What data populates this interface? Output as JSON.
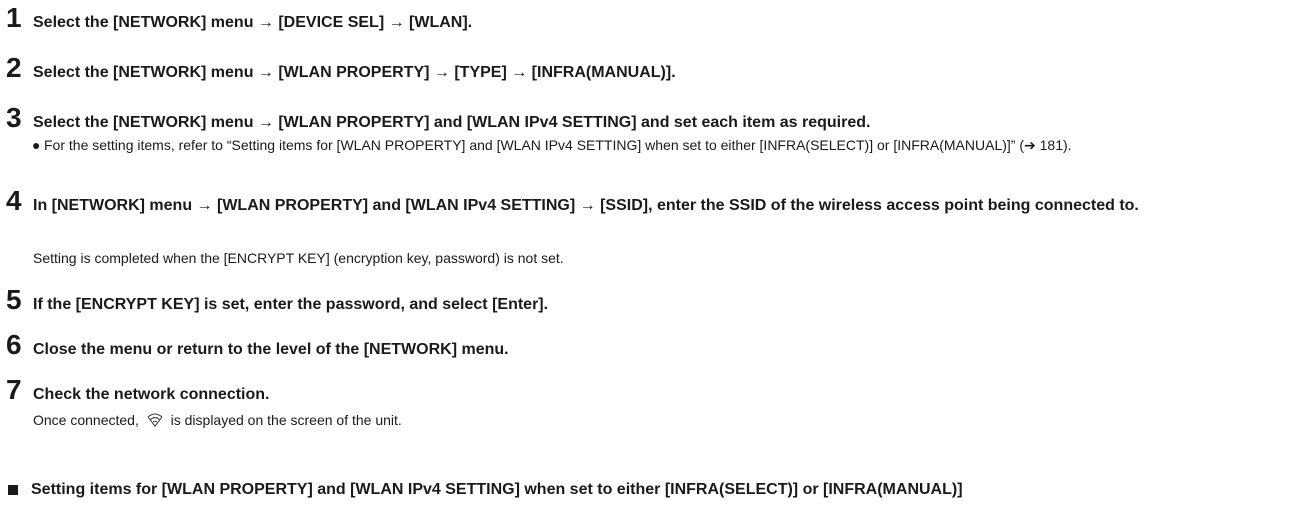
{
  "steps": [
    {
      "num": "1",
      "text": "Select the [NETWORK] menu → [DEVICE SEL] → [WLAN]."
    },
    {
      "num": "2",
      "text": "Select the [NETWORK] menu → [WLAN PROPERTY] → [TYPE] → [INFRA(MANUAL)]."
    },
    {
      "num": "3",
      "text": "Select the [NETWORK] menu → [WLAN PROPERTY] and [WLAN IPv4 SETTING] and set each item as required.",
      "bullet_mark": "●",
      "bullet": "For the setting items, refer to “Setting items for [WLAN PROPERTY] and [WLAN IPv4 SETTING] when set to either [INFRA(SELECT)] or [INFRA(MANUAL)]” (➔ 181)."
    },
    {
      "num": "4",
      "text": "In [NETWORK] menu → [WLAN PROPERTY] and [WLAN IPv4 SETTING] → [SSID], enter the SSID of the wireless access point being connected to.",
      "note": "Setting is completed when the [ENCRYPT KEY] (encryption key, password) is not set."
    },
    {
      "num": "5",
      "text": "If the [ENCRYPT KEY] is set, enter the password, and select [Enter]."
    },
    {
      "num": "6",
      "text": "Close the menu or return to the level of the [NETWORK] menu."
    },
    {
      "num": "7",
      "text": "Check the network connection.",
      "note_before": "Once connected,",
      "note_icon": "wifi-icon",
      "note_after": "is displayed on the screen of the unit."
    }
  ],
  "section_heading": "Setting items for [WLAN PROPERTY] and [WLAN IPv4 SETTING] when set to either [INFRA(SELECT)] or [INFRA(MANUAL)]"
}
